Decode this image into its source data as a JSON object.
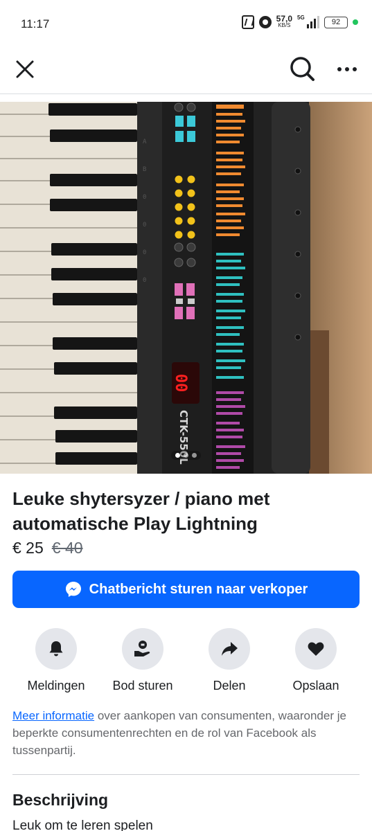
{
  "status_bar": {
    "time": "11:17",
    "net_speed_value": "57,0",
    "net_speed_unit": "KB/S",
    "network_label": "5G",
    "battery": "92"
  },
  "nav": {
    "close_icon": "close-icon",
    "search_icon": "search-icon",
    "more_icon": "more-icon"
  },
  "photo": {
    "keyboard_model_text": "CTK-550L",
    "display_readout": "00",
    "carousel_count": 3,
    "carousel_active": 1
  },
  "listing": {
    "title": "Leuke shytersyzer / piano met automatische Play Lightning",
    "price": "€ 25",
    "old_price": "€ 40"
  },
  "chat_button": {
    "label": "Chatbericht sturen naar verkoper",
    "icon": "messenger-icon"
  },
  "actions": [
    {
      "label": "Meldingen",
      "icon": "bell-icon"
    },
    {
      "label": "Bod sturen",
      "icon": "offer-icon"
    },
    {
      "label": "Delen",
      "icon": "share-icon"
    },
    {
      "label": "Opslaan",
      "icon": "heart-icon"
    }
  ],
  "info": {
    "link_text": "Meer informatie",
    "rest_text": " over aankopen van consumenten, waaronder je beperkte consumentenrechten en de rol van Facebook als tussenpartij."
  },
  "description": {
    "heading": "Beschrijving",
    "text": "Leuk om te leren spelen"
  },
  "colors": {
    "accent": "#0866ff",
    "action_circle": "#e4e6eb",
    "battery_dot": "#22c55e"
  }
}
